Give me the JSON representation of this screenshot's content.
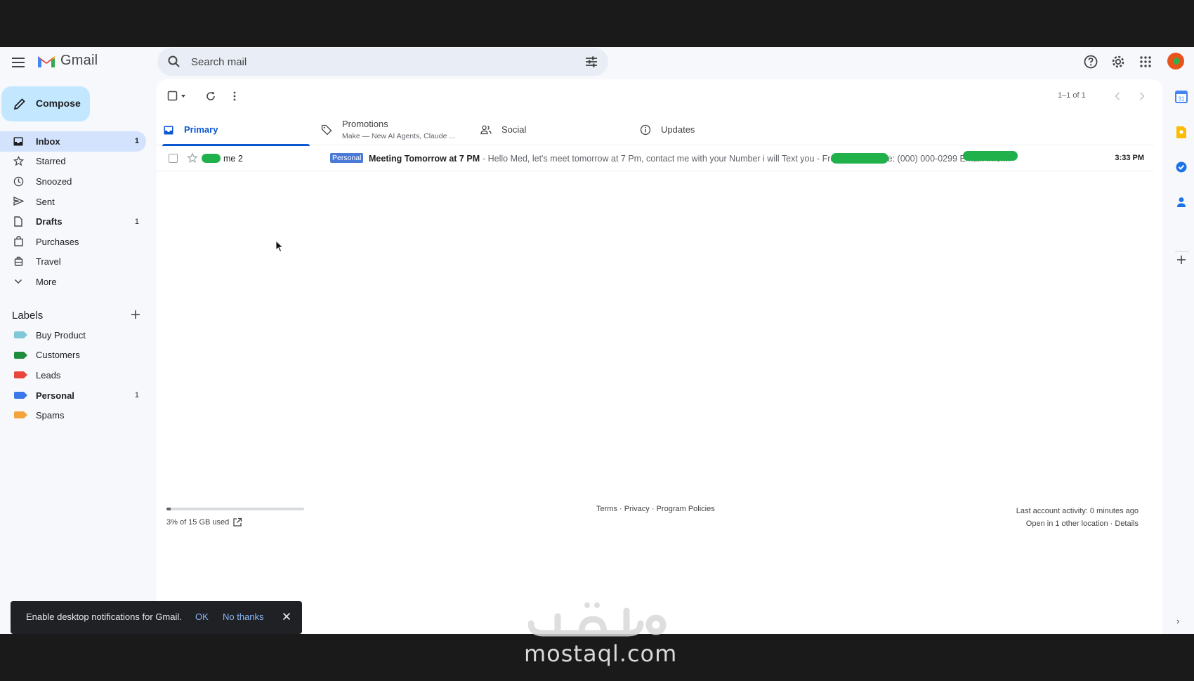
{
  "app": {
    "name": "Gmail"
  },
  "search": {
    "placeholder": "Search mail"
  },
  "compose": {
    "label": "Compose"
  },
  "nav": [
    {
      "label": "Inbox",
      "count": "1",
      "icon": "inbox-icon"
    },
    {
      "label": "Starred",
      "count": "",
      "icon": "star-icon"
    },
    {
      "label": "Snoozed",
      "count": "",
      "icon": "clock-icon"
    },
    {
      "label": "Sent",
      "count": "",
      "icon": "send-icon"
    },
    {
      "label": "Drafts",
      "count": "1",
      "icon": "draft-icon"
    },
    {
      "label": "Purchases",
      "count": "",
      "icon": "bag-icon"
    },
    {
      "label": "Travel",
      "count": "",
      "icon": "luggage-icon"
    },
    {
      "label": "More",
      "count": "",
      "icon": "chevron-down-icon"
    }
  ],
  "labels": {
    "title": "Labels",
    "items": [
      {
        "label": "Buy Product",
        "count": "",
        "color": "#7fc8d8"
      },
      {
        "label": "Customers",
        "count": "",
        "color": "#1e8e3e"
      },
      {
        "label": "Leads",
        "count": "",
        "color": "#e8453c"
      },
      {
        "label": "Personal",
        "count": "1",
        "color": "#3b78e7"
      },
      {
        "label": "Spams",
        "count": "",
        "color": "#f2a33a"
      }
    ]
  },
  "toolbar": {
    "pager": "1–1 of 1"
  },
  "tabs": [
    {
      "label": "Primary",
      "sub": "",
      "icon": "inbox-tab-icon"
    },
    {
      "label": "Promotions",
      "sub": "Make — New AI Agents, Claude ...",
      "icon": "tag-icon"
    },
    {
      "label": "Social",
      "sub": "",
      "icon": "people-icon"
    },
    {
      "label": "Updates",
      "sub": "",
      "icon": "info-icon"
    }
  ],
  "email": {
    "sender": "me 2",
    "badge": "Personal",
    "subject": "Meeting Tomorrow at 7 PM",
    "snippet": " - Hello Med, let's meet tomorrow at 7 Pm, contact me with your Number i will Text you - Freelancer Mobile: (000) 000-0299 Email: info....",
    "time": "3:33 PM"
  },
  "storage": {
    "text": "3% of 15 GB used",
    "percent": 3
  },
  "footer": {
    "terms": "Terms",
    "privacy": "Privacy",
    "policies": "Program Policies",
    "activity": "Last account activity: 0 minutes ago",
    "location": "Open in 1 other location",
    "details": "Details"
  },
  "snackbar": {
    "message": "Enable desktop notifications for Gmail.",
    "ok": "OK",
    "no_thanks": "No thanks"
  },
  "watermark": {
    "text": "mostaql.com"
  }
}
